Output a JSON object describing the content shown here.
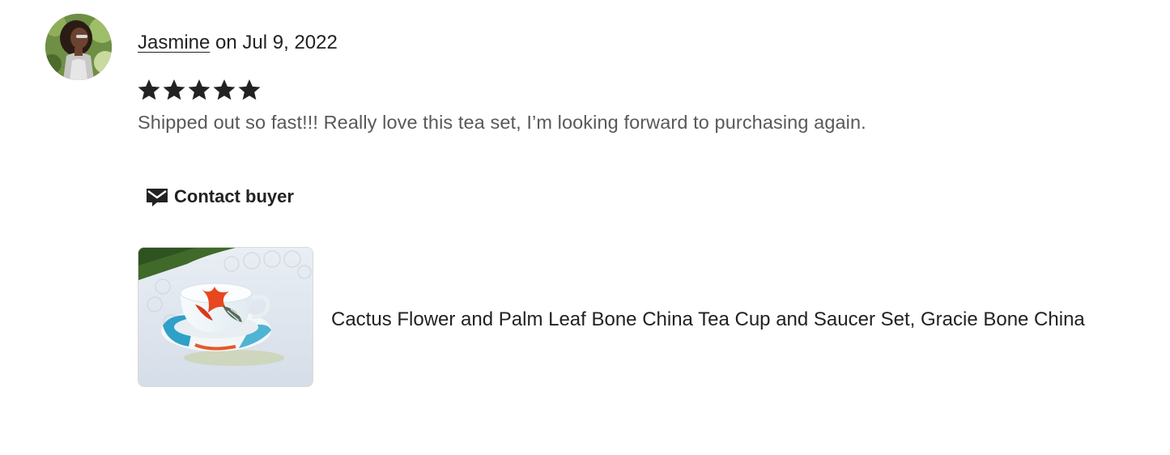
{
  "review": {
    "reviewer_name": "Jasmine",
    "date_text": "on Jul 9, 2022",
    "rating": 5,
    "rating_max": 5,
    "text": "Shipped out so fast!!! Really love this tea set, I’m looking forward to purchasing again."
  },
  "actions": {
    "contact_label": "Contact buyer",
    "contact_icon": "envelope-icon"
  },
  "listing": {
    "title": "Cactus Flower and Palm Leaf Bone China Tea Cup and Saucer Set, Gracie Bone China"
  },
  "colors": {
    "text_primary": "#222222",
    "text_secondary": "#595959",
    "star": "#222222"
  }
}
